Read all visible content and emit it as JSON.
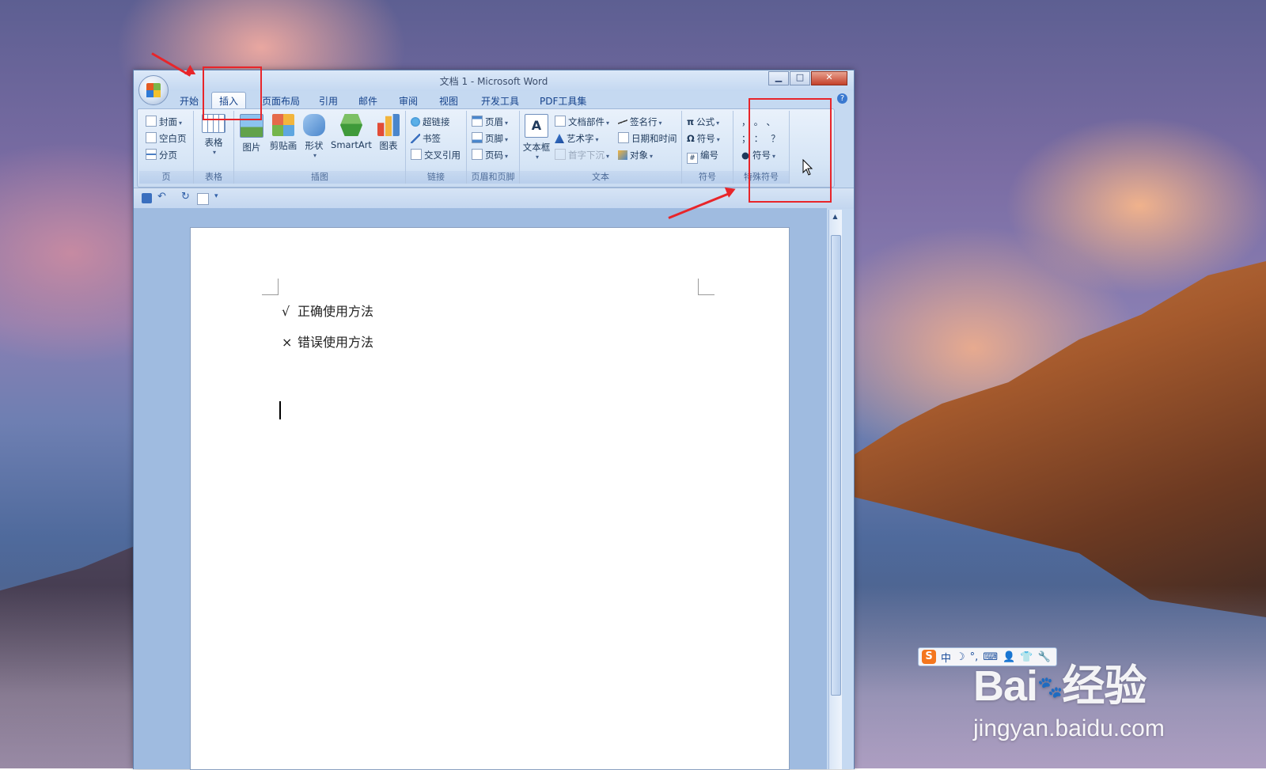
{
  "window": {
    "title": "文档 1 - Microsoft Word"
  },
  "tabs": [
    "开始",
    "插入",
    "页面布局",
    "引用",
    "邮件",
    "审阅",
    "视图",
    "开发工具",
    "PDF工具集"
  ],
  "active_tab": "插入",
  "ribbon": {
    "page_group": {
      "label": "页",
      "items": [
        "封面",
        "空白页",
        "分页"
      ]
    },
    "table_group": {
      "label": "表格",
      "items": [
        "表格"
      ]
    },
    "illustration_group": {
      "label": "插图",
      "items": [
        "图片",
        "剪贴画",
        "形状",
        "SmartArt",
        "图表"
      ]
    },
    "links_group": {
      "label": "链接",
      "items": [
        "超链接",
        "书签",
        "交叉引用"
      ]
    },
    "header_footer_group": {
      "label": "页眉和页脚",
      "items": [
        "页眉",
        "页脚",
        "页码"
      ]
    },
    "text_group": {
      "label": "文本",
      "items": [
        "文本框",
        "文档部件",
        "艺术字",
        "首字下沉",
        "签名行",
        "日期和时间",
        "对象"
      ]
    },
    "symbols_group": {
      "label": "符号",
      "items": [
        "公式",
        "符号",
        "编号"
      ]
    },
    "special_group": {
      "label": "特殊符号",
      "glyphs": [
        "，",
        "。",
        "、",
        "；",
        "：",
        "？"
      ],
      "button": "符号"
    }
  },
  "document": {
    "lines": [
      {
        "symbol": "√",
        "text": "正确使用方法"
      },
      {
        "symbol": "×",
        "text": "错误使用方法"
      }
    ]
  },
  "ime_toolbar": {
    "items": [
      "S",
      "中",
      "☽",
      "°,",
      "⌨",
      "👤",
      "👕",
      "🔧"
    ]
  },
  "watermark": {
    "brand": "Bai",
    "brand_cn": "经验",
    "url": "jingyan.baidu.com"
  },
  "colors": {
    "annotation_red": "#e8252a",
    "ribbon_text": "#1e395b",
    "tab_text": "#15428b"
  }
}
